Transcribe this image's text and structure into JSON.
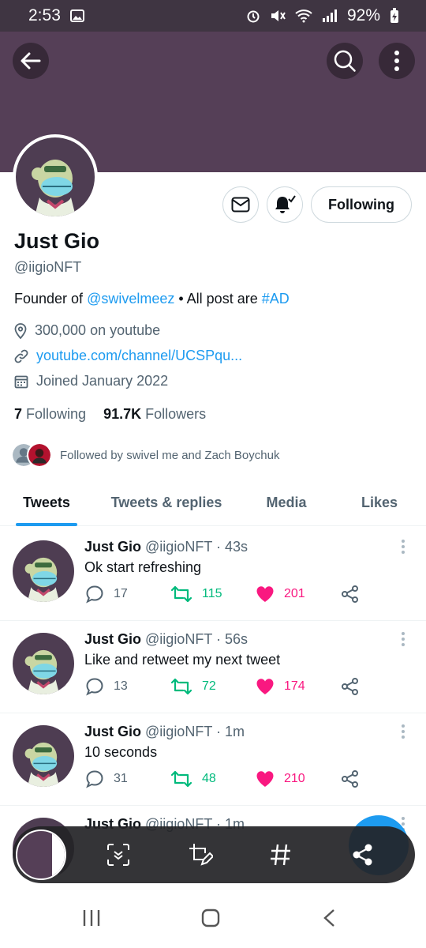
{
  "status_bar": {
    "time": "2:53",
    "battery": "92%"
  },
  "profile": {
    "name": "Just Gio",
    "handle": "@iigioNFT",
    "bio_prefix": "Founder of ",
    "bio_mention": "@swivelmeez",
    "bio_middle": " • All post are ",
    "bio_hashtag": "#AD",
    "location": "300,000 on youtube",
    "website": "youtube.com/channel/UCSPqu...",
    "joined": "Joined January 2022",
    "following_count": "7",
    "following_label": "Following",
    "followers_count": "91.7K",
    "followers_label": "Followers",
    "followed_by": "Followed by swivel me and Zach Boychuk",
    "follow_button": "Following"
  },
  "tabs": [
    {
      "label": "Tweets"
    },
    {
      "label": "Tweets & replies"
    },
    {
      "label": "Media"
    },
    {
      "label": "Likes"
    }
  ],
  "tweets": [
    {
      "name": "Just Gio",
      "handle": "@iigioNFT",
      "time": "· 43s",
      "text": "Ok start refreshing",
      "replies": "17",
      "retweets": "115",
      "likes": "201"
    },
    {
      "name": "Just Gio",
      "handle": "@iigioNFT",
      "time": "· 56s",
      "text": "Like and retweet my next tweet",
      "replies": "13",
      "retweets": "72",
      "likes": "174"
    },
    {
      "name": "Just Gio",
      "handle": "@iigioNFT",
      "time": "· 1m",
      "text": "10 seconds",
      "replies": "31",
      "retweets": "48",
      "likes": "210"
    },
    {
      "name": "Just Gio",
      "handle": "@iigioNFT",
      "time": "· 1m"
    }
  ],
  "colors": {
    "banner": "#553f57",
    "accent": "#1d9bf0",
    "retweet": "#00ba7c",
    "like": "#f91880"
  }
}
